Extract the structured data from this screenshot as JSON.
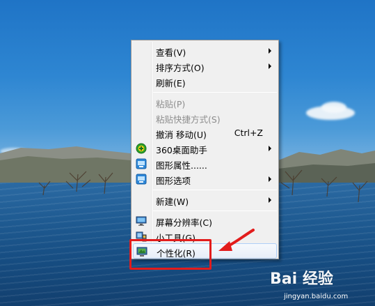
{
  "menu": {
    "items": [
      {
        "label": "查看(V)",
        "submenu": true
      },
      {
        "label": "排序方式(O)",
        "submenu": true
      },
      {
        "label": "刷新(E)"
      },
      {
        "label": "粘贴(P)",
        "disabled": true
      },
      {
        "label": "粘贴快捷方式(S)",
        "disabled": true
      },
      {
        "label": "撤消 移动(U)",
        "shortcut": "Ctrl+Z"
      },
      {
        "label": "360桌面助手",
        "icon": "360-assistant-icon",
        "submenu": true
      },
      {
        "label": "图形属性......",
        "icon": "graphics-properties-icon"
      },
      {
        "label": "图形选项",
        "icon": "graphics-options-icon",
        "submenu": true
      },
      {
        "label": "新建(W)",
        "submenu": true
      },
      {
        "label": "屏幕分辨率(C)",
        "icon": "screen-resolution-icon"
      },
      {
        "label": "小工具(G)",
        "icon": "gadgets-icon"
      },
      {
        "label": "个性化(R)",
        "icon": "personalize-icon",
        "highlighted": true
      }
    ]
  },
  "watermark": {
    "logo": "Bai 经验",
    "url": "jingyan.baidu.com"
  },
  "colors": {
    "annotation": "#e21c1c",
    "menu_background": "#f0f0f0"
  }
}
